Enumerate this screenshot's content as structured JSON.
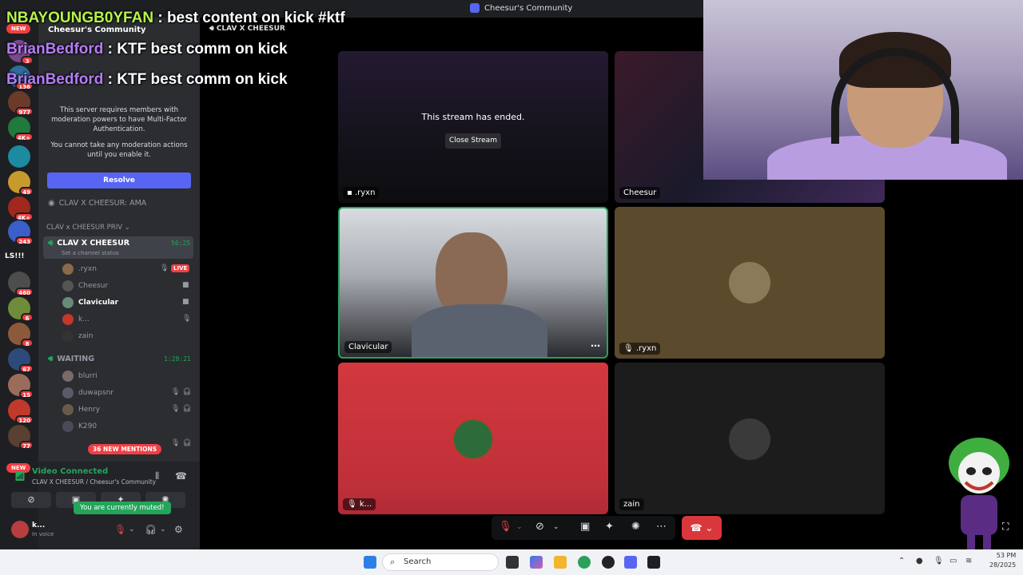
{
  "window": {
    "title": "Cheesur's Community"
  },
  "servers": {
    "new_top": "NEW",
    "new_bottom": "NEW",
    "badges": [
      "3",
      "136",
      "977",
      "4K+",
      "49",
      "4K+",
      "243",
      "460",
      "6",
      "8",
      "67",
      "15",
      "120",
      "77"
    ],
    "text_server": "LS!!!"
  },
  "sidebar": {
    "server_name": "Cheesur's Community",
    "mfa_line1": "This server requires members with moderation powers to have Multi-Factor Authentication.",
    "mfa_line2": "You cannot take any moderation actions until you enable it.",
    "resolve_label": "Resolve",
    "stage_channel": "CLAV X CHEESUR: AMA",
    "category": "CLAV x CHEESUR PRIV",
    "voice_channel_1": {
      "name": "CLAV X CHEESUR",
      "timer": "56:25",
      "status": "Set a channel status",
      "members": [
        ".ryxn",
        "Cheesur",
        "Clavicular",
        "k...",
        "zain"
      ],
      "live_label": "LIVE"
    },
    "voice_channel_2": {
      "name": "WAITING",
      "timer": "1:28:21",
      "members": [
        "blurri",
        "duwapsnr",
        "Henry",
        "K290"
      ]
    },
    "mentions_pill": "36 NEW MENTIONS"
  },
  "voice_panel": {
    "status": "Video Connected",
    "location": "CLAV X CHEESUR / Cheesur's Community",
    "muted_toast": "You are currently muted!",
    "user_name": "k...",
    "user_status": "In voice"
  },
  "chat": [
    {
      "user": "NBAYOUNGB0YFAN",
      "message": " : best content on kick #ktf"
    },
    {
      "user": "BrianBedford",
      "message": " : KTF best comm on kick"
    },
    {
      "user": "BrianBedford",
      "message": " : KTF best comm on kick"
    }
  ],
  "stage": {
    "channel_title": "CLAV X CHEESUR",
    "ended_text": "This stream has ended.",
    "close_stream_label": "Close Stream",
    "tiles": [
      ".ryxn",
      "Cheesur",
      "Clavicular",
      ".ryxn",
      "k...",
      "zain"
    ],
    "more_icon": "⋯"
  },
  "taskbar": {
    "search_placeholder": "Search",
    "time": "53 PM",
    "date": "28/2025"
  },
  "colors": {
    "blurple": "#5865f2",
    "green": "#23a55a",
    "red": "#f23f43",
    "chat_name_green": "#b6f34a",
    "chat_name_purple": "#b57cf5"
  }
}
